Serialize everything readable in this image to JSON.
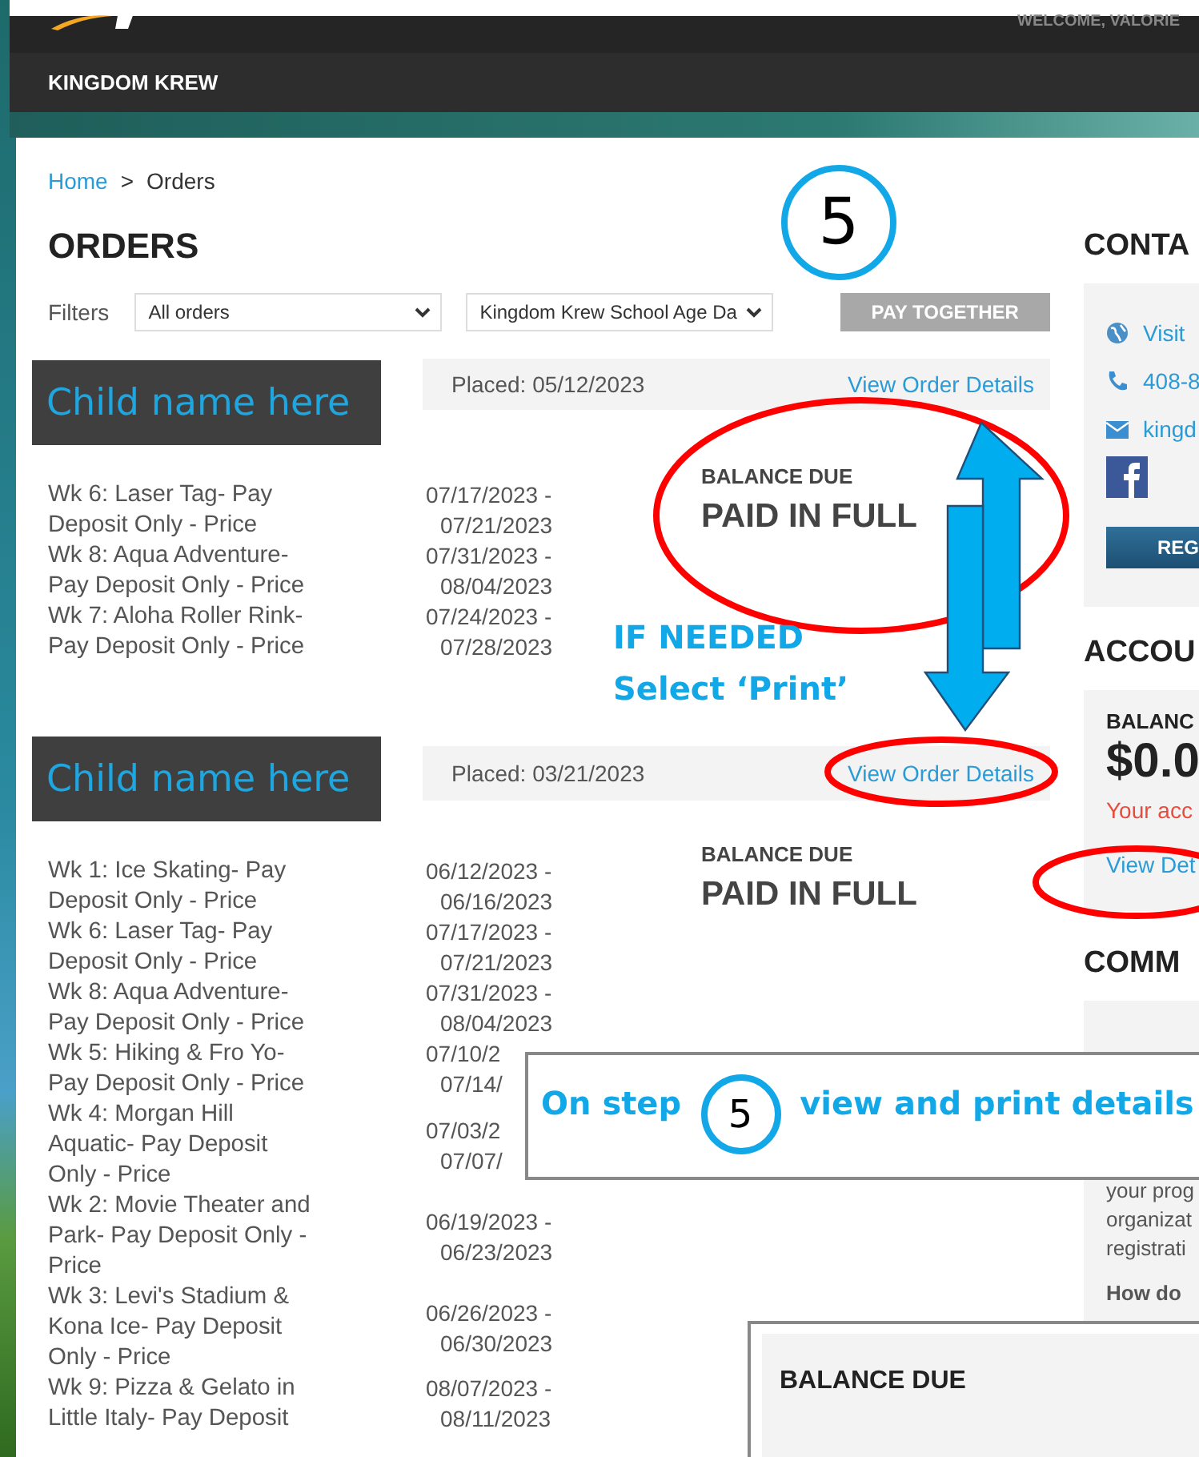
{
  "header": {
    "welcome": "WELCOME, VALORIE",
    "org": "KINGDOM KREW"
  },
  "breadcrumb": [
    {
      "label": "Home",
      "link": true
    },
    {
      "label": ">",
      "link": false
    },
    {
      "label": "Orders",
      "link": false
    }
  ],
  "title": "ORDERS",
  "filters": {
    "label": "Filters",
    "selects": [
      "All orders",
      "Kingdom Krew School Age Da"
    ],
    "button": "PAY TOGETHER",
    "button_disabled": true
  },
  "orders": [
    {
      "child": "Child name here",
      "placed": "Placed: 05/12/2023",
      "link": "View Order Details",
      "balance_label": "BALANCE DUE",
      "balance": "PAID IN FULL",
      "items": [
        {
          "name": "Wk 6: Laser Tag- Pay Deposit Only - Price",
          "start": "07/17/2023 -",
          "end": "07/21/2023"
        },
        {
          "name": "Wk 8: Aqua Adventure- Pay Deposit Only - Price",
          "start": "07/31/2023 -",
          "end": "08/04/2023"
        },
        {
          "name": "Wk 7: Aloha Roller Rink- Pay Deposit Only - Price",
          "start": "07/24/2023 -",
          "end": "07/28/2023"
        }
      ]
    },
    {
      "child": "Child name here",
      "placed": "Placed: 03/21/2023",
      "link": "View Order Details",
      "balance_label": "BALANCE DUE",
      "balance": "PAID IN FULL",
      "items": [
        {
          "name": "Wk 1: Ice Skating- Pay Deposit Only - Price",
          "start": "06/12/2023 -",
          "end": "06/16/2023"
        },
        {
          "name": "Wk 6: Laser Tag- Pay Deposit Only - Price",
          "start": "07/17/2023 -",
          "end": "07/21/2023"
        },
        {
          "name": "Wk 8: Aqua Adventure- Pay Deposit Only - Price",
          "start": "07/31/2023 -",
          "end": "08/04/2023"
        },
        {
          "name": "Wk 5: Hiking & Fro Yo- Pay Deposit Only - Price",
          "start": "07/10/2",
          "end": "07/14/"
        },
        {
          "name": "Wk 4: Morgan Hill Aquatic- Pay Deposit Only - Price",
          "start": "07/03/2",
          "end": "07/07/"
        },
        {
          "name": "Wk 2: Movie Theater and Park- Pay Deposit Only - Price",
          "start": "06/19/2023 -",
          "end": "06/23/2023"
        },
        {
          "name": "Wk 3: Levi's Stadium & Kona Ice- Pay Deposit Only - Price",
          "start": "06/26/2023 -",
          "end": "06/30/2023"
        },
        {
          "name": "Wk 9: Pizza & Gelato in Little Italy- Pay Deposit",
          "start": "08/07/2023 -",
          "end": "08/11/2023"
        }
      ]
    }
  ],
  "sidebar": {
    "contact_title": "CONTA",
    "contacts": [
      {
        "kind": "web",
        "text": "Visit "
      },
      {
        "kind": "phone",
        "text": "408-8"
      },
      {
        "kind": "email",
        "text": "kingd"
      }
    ],
    "register": "REG",
    "account_title": "ACCOU",
    "balance_label": "BALANC",
    "balance": "$0.0",
    "balance_note": "Your acc",
    "details_link": "View Det",
    "comm_title": "COMM",
    "faq_lines": [
      "your prog",
      "organizat",
      "registrati"
    ],
    "faq_next": "How do"
  },
  "annotations": {
    "step": "5",
    "if_needed": "IF NEEDED",
    "select_print": "Select ‘Print’",
    "callout": {
      "before": "On step",
      "step": "5",
      "after": "view and print details"
    }
  },
  "inset": {
    "label": "BALANCE DUE"
  }
}
